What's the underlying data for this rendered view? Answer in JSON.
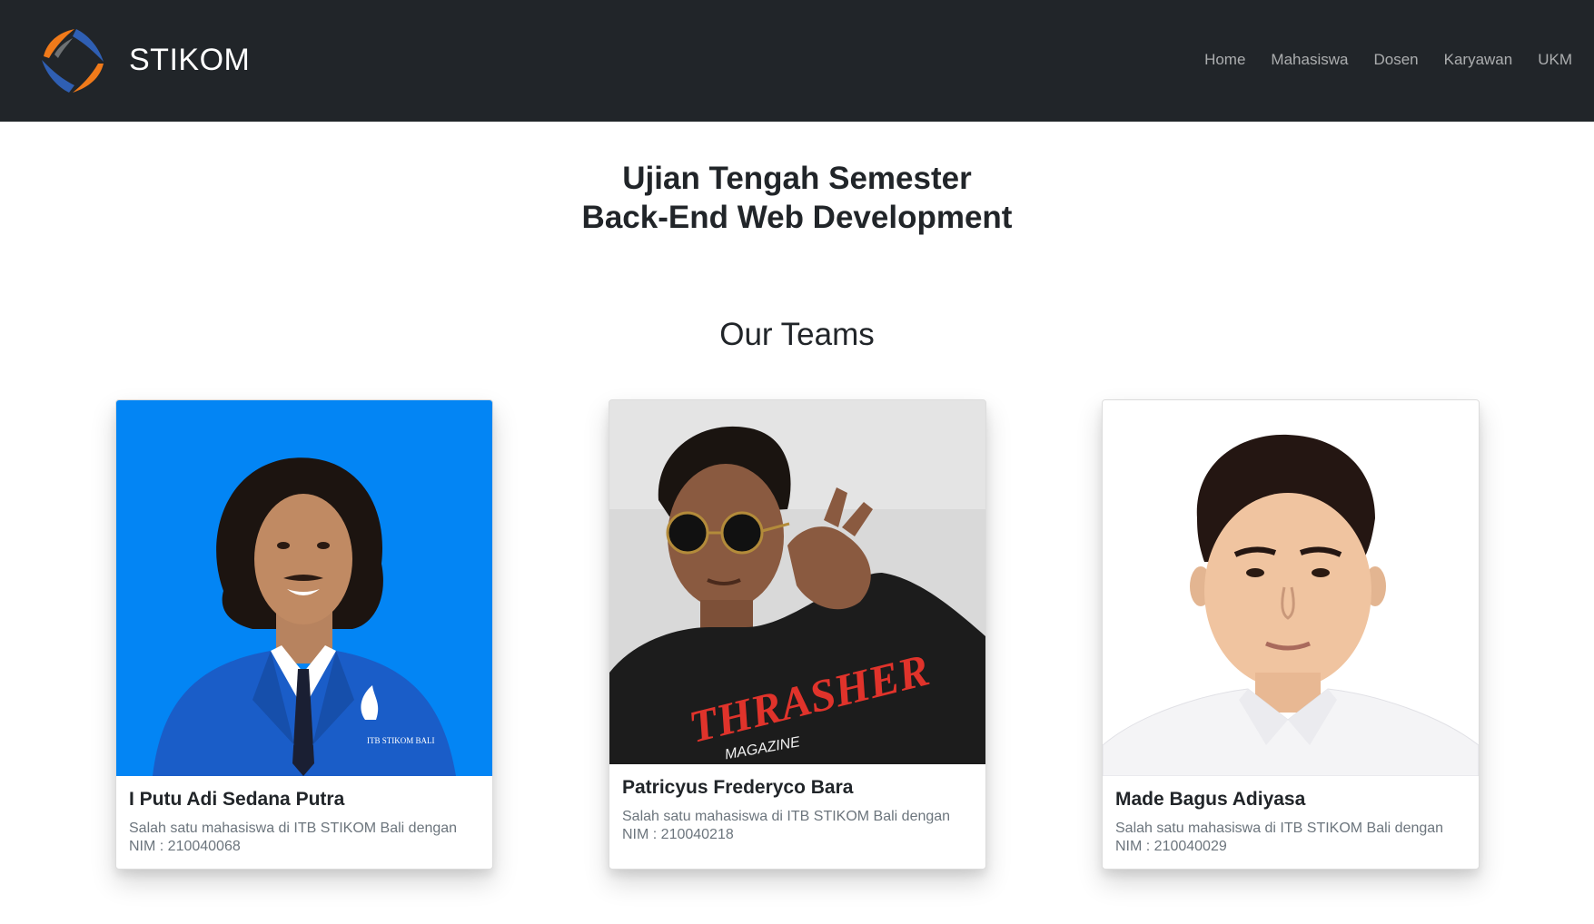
{
  "navbar": {
    "brand": "STIKOM",
    "links": [
      "Home",
      "Mahasiswa",
      "Dosen",
      "Karyawan",
      "UKM"
    ]
  },
  "hero": {
    "line1": "Ujian Tengah Semester",
    "line2": "Back-End Web Development"
  },
  "section_title": "Our Teams",
  "team": [
    {
      "name": "I Putu Adi Sedana Putra",
      "desc": "Salah satu mahasiswa di ITB STIKOM Bali dengan",
      "nim": "NIM : 210040068",
      "jacket_text": "ITB STIKOM BALI"
    },
    {
      "name": "Patricyus Frederyco Bara",
      "desc": "Salah satu mahasiswa di ITB STIKOM Bali dengan",
      "nim": "NIM : 210040218",
      "shirt_text": "THRASHER",
      "shirt_subtext": "MAGAZINE"
    },
    {
      "name": "Made Bagus Adiyasa",
      "desc": "Salah satu mahasiswa di ITB STIKOM Bali dengan",
      "nim": "NIM : 210040029"
    }
  ],
  "colors": {
    "navbar_bg": "#212529",
    "logo_orange": "#f07a1a",
    "logo_blue": "#2f5fb3",
    "photo1_bg": "#0385f4",
    "photo2_bg": "#d9d9d9",
    "photo3_bg": "#ffffff"
  },
  "icons": {
    "brand_logo": "stikom-logo-icon"
  }
}
